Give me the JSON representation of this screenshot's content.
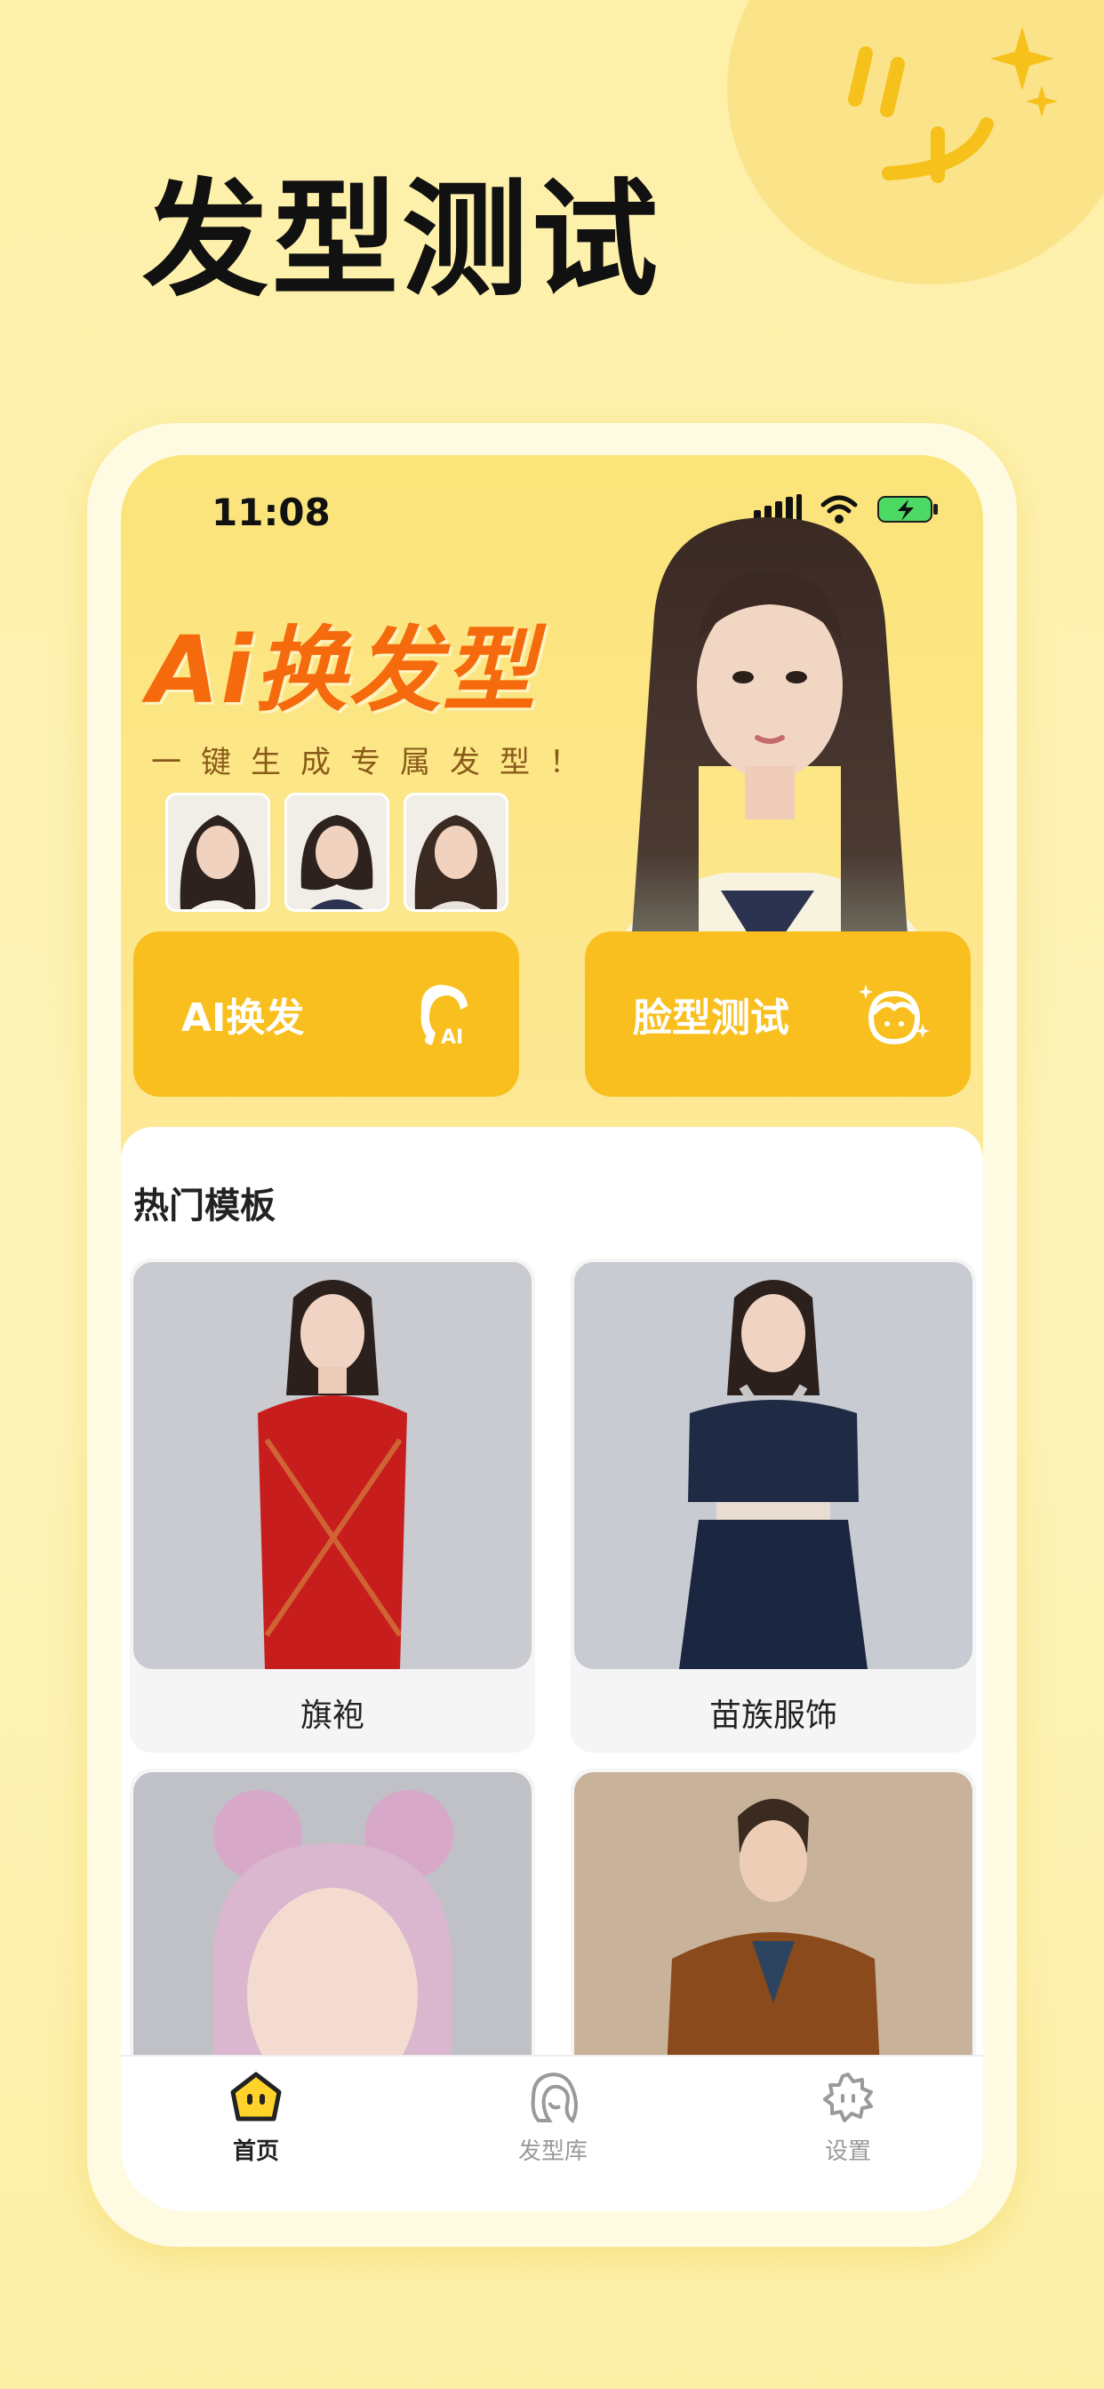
{
  "headline": "发型测试",
  "status_bar": {
    "time": "11:08"
  },
  "banner": {
    "title": "Ai换发型",
    "subtitle": "一键生成专属发型！"
  },
  "actions": [
    {
      "label": "AI换发",
      "icon": "hair-ai-icon"
    },
    {
      "label": "脸型测试",
      "icon": "face-sparkle-icon"
    }
  ],
  "section": {
    "title": "热门模板"
  },
  "templates": [
    {
      "label": "旗袍"
    },
    {
      "label": "苗族服饰"
    },
    {
      "label": ""
    },
    {
      "label": ""
    }
  ],
  "tab_bar": {
    "items": [
      {
        "label": "首页",
        "icon": "home-face-icon",
        "active": true
      },
      {
        "label": "发型库",
        "icon": "hair-library-icon",
        "active": false
      },
      {
        "label": "设置",
        "icon": "settings-gear-icon",
        "active": false
      }
    ]
  },
  "colors": {
    "accent": "#f8bf1e",
    "banner_title": "#f56a0c",
    "tab_active": "#222222",
    "tab_inactive": "#9a9a9a"
  }
}
